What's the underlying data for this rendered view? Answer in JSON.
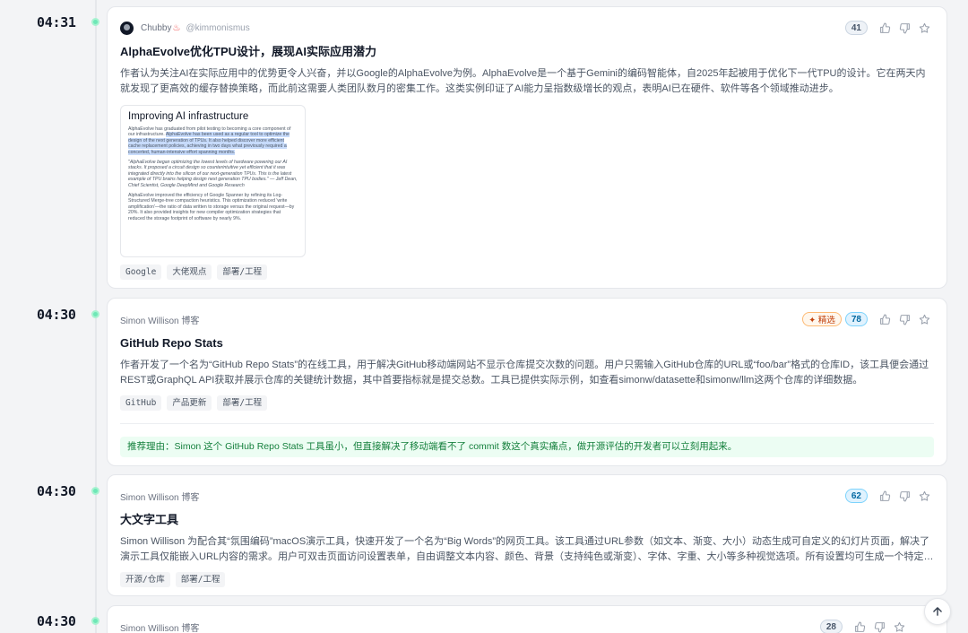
{
  "entries": [
    {
      "time": "04:31",
      "author": "Chubby",
      "author_emoji": "♨",
      "handle": "@kimmonismus",
      "score": "41",
      "title": "AlphaEvolve优化TPU设计，展现AI实际应用潜力",
      "summary": "作者认为关注AI在实际应用中的优势更令人兴奋，并以Google的AlphaEvolve为例。AlphaEvolve是一个基于Gemini的编码智能体，自2025年起被用于优化下一代TPU的设计。它在两天内就发现了更高效的缓存替换策略，而此前这需要人类团队数月的密集工作。这类实例印证了AI能力呈指数级增长的观点，表明AI已在硬件、软件等各个领域推动进步。",
      "thumbnail": {
        "title": "Improving AI infrastructure",
        "p1_plain": "AlphaEvolve has graduated from pilot testing to becoming a core component of our infrastructure. ",
        "p1_highlight": "AlphaEvolve has been used as a regular tool to optimize the design of the next generation of TPUs. It also helped discover more efficient cache replacement policies, achieving in two days what previously required a concerted, human-intensive effort spanning months.",
        "p2": "\"AlphaEvolve began optimizing the lowest levels of hardware powering our AI stacks. It proposed a circuit design so counterintuitive yet efficient that it was integrated directly into the silicon of our next-generation TPUs. This is the latest example of TPU brains helping design next generation TPU bodies.\" — Jeff Dean, Chief Scientist, Google DeepMind and Google Research",
        "p3": "AlphaEvolve improved the efficiency of Google Spanner by refining its Log-Structured Merge-tree compaction heuristics. This optimization reduced 'write amplification'—the ratio of data written to storage versus the original request—by 20%. It also provided insights for new compiler optimization strategies that reduced the storage footprint of software by nearly 9%."
      },
      "tags": [
        "Google",
        "大佬观点",
        "部署/工程"
      ]
    },
    {
      "time": "04:30",
      "author": "Simon Willison 博客",
      "featured_label": "✦ 精选",
      "score": "78",
      "title": "GitHub Repo Stats",
      "summary": "作者开发了一个名为“GitHub Repo Stats”的在线工具，用于解决GitHub移动端网站不显示仓库提交次数的问题。用户只需输入GitHub仓库的URL或“foo/bar”格式的仓库ID，该工具便会通过REST或GraphQL API获取并展示仓库的关键统计数据，其中首要指标就是提交总数。工具已提供实际示例，如查看simonw/datasette和simonw/llm这两个仓库的详细数据。",
      "tags": [
        "GitHub",
        "产品更新",
        "部署/工程"
      ],
      "reason": "推荐理由：Simon 这个 GitHub Repo Stats 工具虽小，但直接解决了移动端看不了 commit 数这个真实痛点，做开源评估的开发者可以立刻用起来。"
    },
    {
      "time": "04:30",
      "author": "Simon Willison 博客",
      "score": "62",
      "title": "大文字工具",
      "summary": "Simon Willison 为配合其“氛围编码”macOS演示工具，快速开发了一个名为“Big Words”的网页工具。该工具通过URL参数（如文本、渐变、大小）动态生成可自定义的幻灯片页面，解决了演示工具仅能嵌入URL内容的需求。用户可双击页面访问设置表单，自由调整文本内容、颜色、背景（支持纯色或渐变）、字体、字重、大小等多种视觉选项。所有设置均可生成一个特定的URL，方便分享和嵌入。",
      "tags": [
        "开源/仓库",
        "部署/工程"
      ]
    },
    {
      "time": "04:30",
      "author": "Simon Willison 博客",
      "score": "28"
    }
  ],
  "colors": {
    "accent_green": "#6ee7b7",
    "featured_orange": "#c2410c",
    "score_blue": "#0369a1"
  }
}
